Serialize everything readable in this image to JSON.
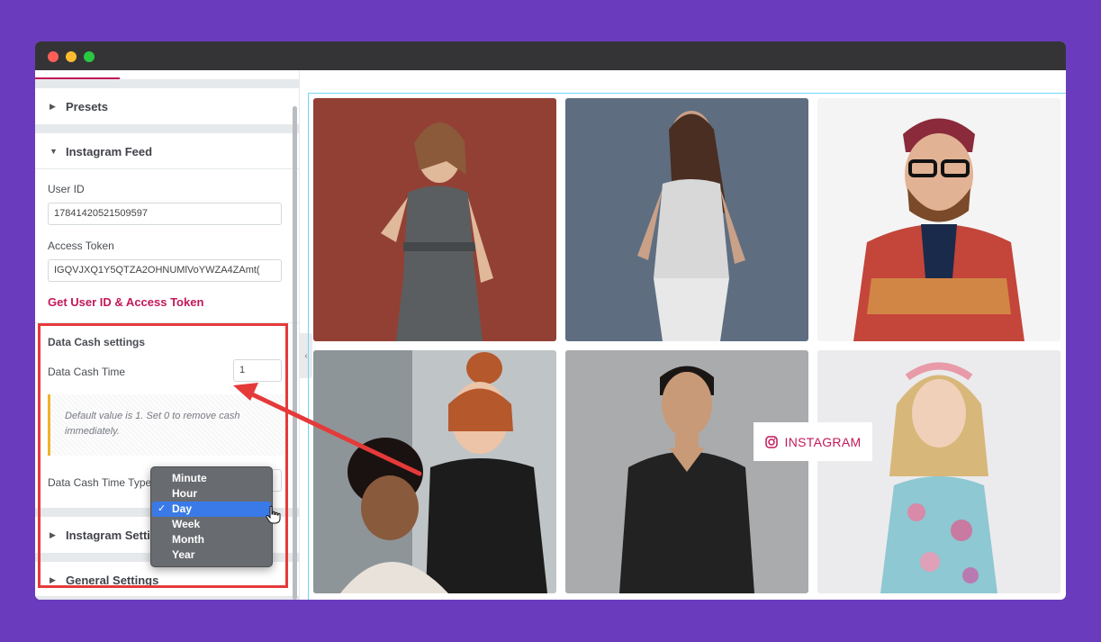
{
  "sidebar": {
    "presets_label": "Presets",
    "instagram_feed_label": "Instagram Feed",
    "user_id_label": "User ID",
    "user_id_value": "17841420521509597",
    "access_token_label": "Access Token",
    "access_token_value": "IGQVJXQ1Y5QTZA2OHNUMlVoYWZA4ZAmt(",
    "token_link": "Get User ID & Access Token",
    "data_cash_title": "Data Cash settings",
    "data_cash_time_label": "Data Cash Time",
    "data_cash_time_value": "1",
    "notice_text": "Default value is 1. Set 0 to remove cash immediately.",
    "data_cash_time_type_label": "Data Cash Time Type",
    "instagram_settings_label": "Instagram Settings",
    "general_settings_label": "General Settings"
  },
  "dropdown": {
    "options": [
      "Minute",
      "Hour",
      "Day",
      "Week",
      "Month",
      "Year"
    ],
    "selected": "Day",
    "check": "✓"
  },
  "preview": {
    "instagram_button": "INSTAGRAM"
  },
  "colors": {
    "background": "#6a3bbd",
    "accent": "#c3185a",
    "highlight": "#e53a3a",
    "selected_option": "#3a7ae8"
  }
}
